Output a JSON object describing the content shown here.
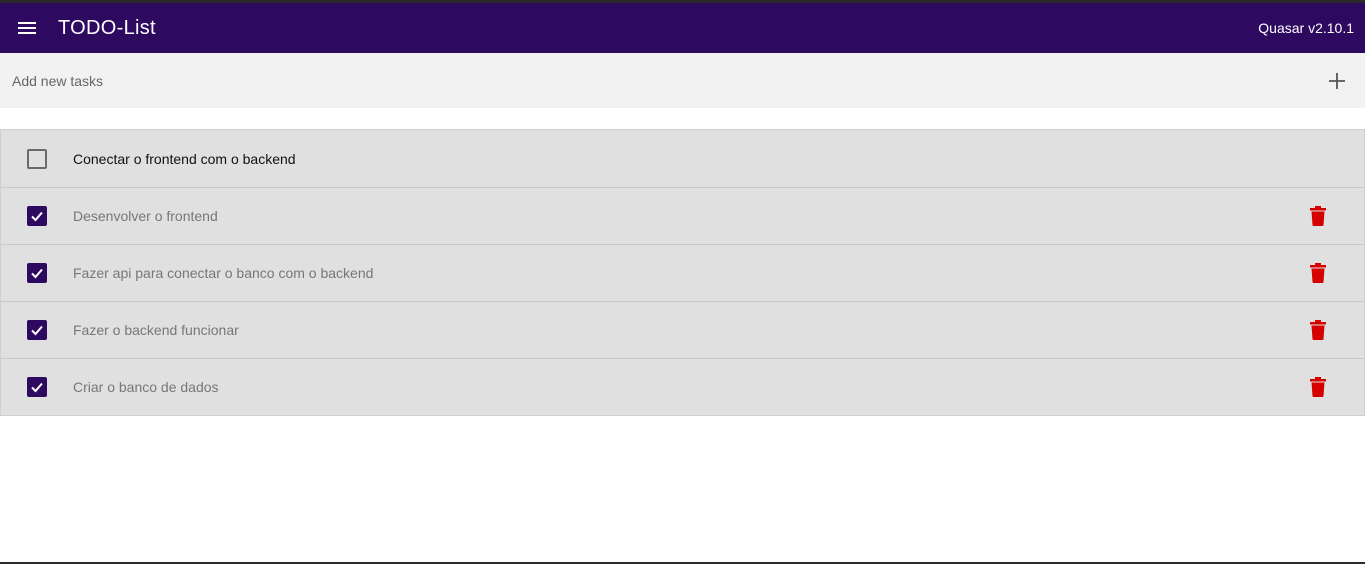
{
  "header": {
    "title": "TODO-List",
    "version": "Quasar v2.10.1",
    "menu_icon": "menu-icon",
    "background": "#2d0a60"
  },
  "add_task": {
    "placeholder": "Add new tasks",
    "value": "",
    "add_icon": "plus-icon"
  },
  "tasks": [
    {
      "label": "Conectar o frontend com o backend",
      "done": false
    },
    {
      "label": "Desenvolver o frontend",
      "done": true
    },
    {
      "label": "Fazer api para conectar o banco com o backend",
      "done": true
    },
    {
      "label": "Fazer o backend funcionar",
      "done": true
    },
    {
      "label": "Criar o banco de dados",
      "done": true
    }
  ],
  "colors": {
    "accent": "#2d0a60",
    "delete": "#d50000",
    "row_background": "#e0e0e0"
  }
}
